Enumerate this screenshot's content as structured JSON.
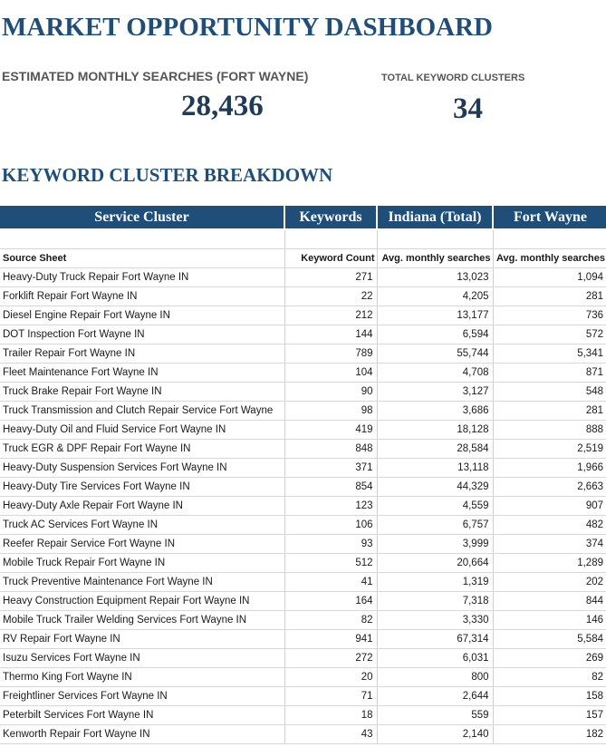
{
  "dashboard": {
    "title": "MARKET OPPORTUNITY DASHBOARD",
    "kpi_searches_label": "ESTIMATED MONTHLY SEARCHES (FORT WAYNE)",
    "kpi_searches_value": "28,436",
    "kpi_clusters_label": "TOTAL KEYWORD CLUSTERS",
    "kpi_clusters_value": "34",
    "section_title": "KEYWORD CLUSTER BREAKDOWN"
  },
  "table": {
    "headers": [
      "Service Cluster",
      "Keywords",
      "Indiana (Total)",
      "Fort Wayne"
    ],
    "subheaders": [
      "Source Sheet",
      "Keyword Count",
      "Avg. monthly searches",
      "Avg. monthly searches"
    ],
    "rows": [
      [
        "Heavy-Duty Truck Repair Fort Wayne IN",
        "271",
        "13,023",
        "1,094"
      ],
      [
        "Forklift Repair Fort Wayne IN",
        "22",
        "4,205",
        "281"
      ],
      [
        "Diesel Engine Repair Fort Wayne IN",
        "212",
        "13,177",
        "736"
      ],
      [
        "DOT Inspection Fort Wayne IN",
        "144",
        "6,594",
        "572"
      ],
      [
        "Trailer Repair Fort Wayne IN",
        "789",
        "55,744",
        "5,341"
      ],
      [
        "Fleet Maintenance Fort Wayne IN",
        "104",
        "4,708",
        "871"
      ],
      [
        "Truck Brake Repair Fort Wayne IN",
        "90",
        "3,127",
        "548"
      ],
      [
        "Truck Transmission and Clutch Repair Service Fort Wayne",
        "98",
        "3,686",
        "281"
      ],
      [
        "Heavy-Duty Oil and Fluid Service Fort Wayne IN",
        "419",
        "18,128",
        "888"
      ],
      [
        "Truck EGR & DPF Repair Fort Wayne IN",
        "848",
        "28,584",
        "2,519"
      ],
      [
        "Heavy-Duty Suspension Services Fort Wayne IN",
        "371",
        "13,118",
        "1,966"
      ],
      [
        "Heavy-Duty Tire Services Fort Wayne IN",
        "854",
        "44,329",
        "2,663"
      ],
      [
        "Heavy-Duty Axle Repair Fort Wayne IN",
        "123",
        "4,559",
        "907"
      ],
      [
        "Truck AC Services Fort Wayne IN",
        "106",
        "6,757",
        "482"
      ],
      [
        "Reefer Repair Service Fort Wayne IN",
        "93",
        "3,999",
        "374"
      ],
      [
        "Mobile Truck Repair Fort Wayne IN",
        "512",
        "20,664",
        "1,289"
      ],
      [
        "Truck Preventive Maintenance Fort Wayne IN",
        "41",
        "1,319",
        "202"
      ],
      [
        "Heavy Construction Equipment Repair Fort Wayne IN",
        "164",
        "7,318",
        "844"
      ],
      [
        "Mobile Truck Trailer Welding Services Fort Wayne IN",
        "82",
        "3,330",
        "146"
      ],
      [
        "RV Repair Fort Wayne IN",
        "941",
        "67,314",
        "5,584"
      ],
      [
        "Isuzu Services Fort Wayne IN",
        "272",
        "6,031",
        "269"
      ],
      [
        "Thermo King Fort Wayne IN",
        "20",
        "800",
        "82"
      ],
      [
        "Freightliner Services Fort Wayne IN",
        "71",
        "2,644",
        "158"
      ],
      [
        "Peterbilt Services Fort Wayne IN",
        "18",
        "559",
        "157"
      ],
      [
        "Kenworth Repair Fort Wayne IN",
        "43",
        "2,140",
        "182"
      ]
    ]
  }
}
